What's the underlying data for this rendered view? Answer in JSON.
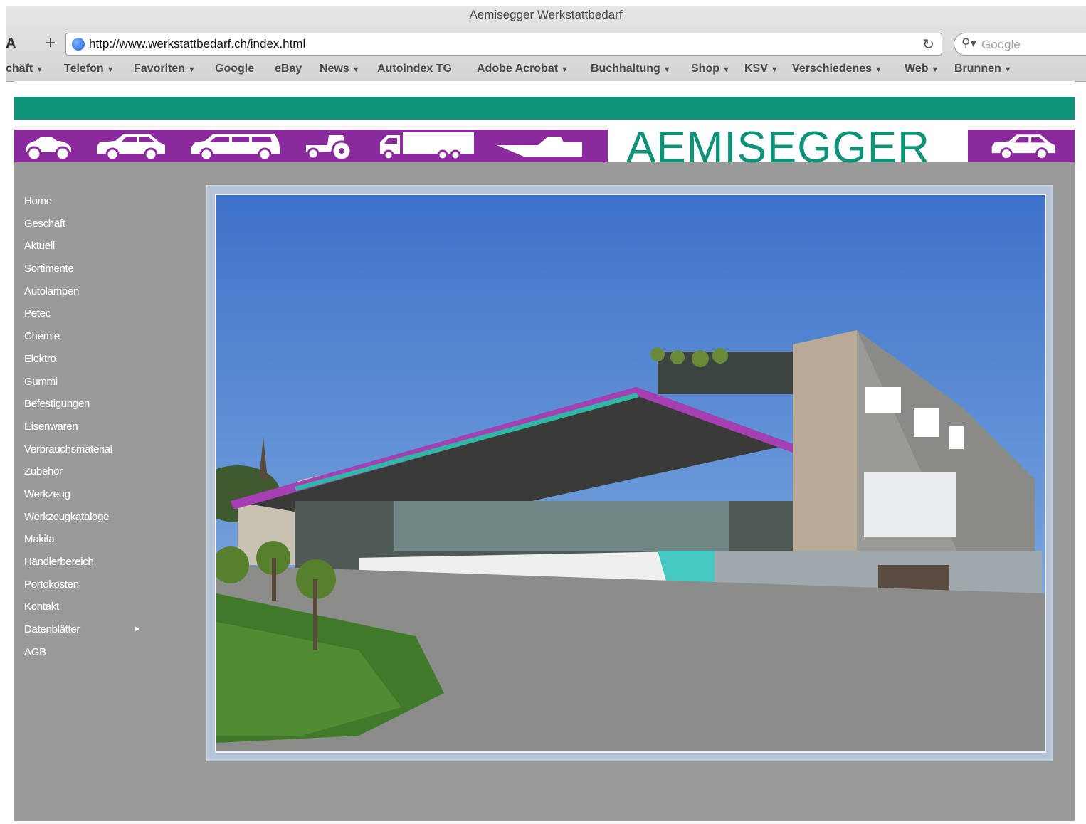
{
  "browser": {
    "window_title": "Aemisegger Werkstattbedarf",
    "left_button": "A",
    "add_button": "+",
    "url": "http://www.werkstattbedarf.ch/index.html",
    "search_placeholder": "Google",
    "bookmarks": [
      {
        "label": "chäft",
        "menu": true
      },
      {
        "label": "Telefon",
        "menu": true
      },
      {
        "label": "Favoriten",
        "menu": true
      },
      {
        "label": "Google",
        "menu": false
      },
      {
        "label": "eBay",
        "menu": false
      },
      {
        "label": "News",
        "menu": true
      },
      {
        "label": "Autoindex TG",
        "menu": false
      },
      {
        "label": "Adobe Acrobat",
        "menu": true
      },
      {
        "label": "Buchhaltung",
        "menu": true
      },
      {
        "label": "Shop",
        "menu": true
      },
      {
        "label": "KSV",
        "menu": true
      },
      {
        "label": "Verschiedenes",
        "menu": true
      },
      {
        "label": "Web",
        "menu": true
      },
      {
        "label": "Brunnen",
        "menu": true
      }
    ]
  },
  "site": {
    "brand": "AEMISEGGER",
    "colors": {
      "teal": "#0e9278",
      "purple": "#8a2a9c",
      "background": "#9a9a9a"
    },
    "vehicle_icons": [
      "quad-icon",
      "car-icon",
      "van-icon",
      "tractor-icon",
      "truck-trailer-icon",
      "boat-icon",
      "car-icon"
    ],
    "nav": [
      {
        "label": "Home"
      },
      {
        "label": "Geschäft"
      },
      {
        "label": "Aktuell"
      },
      {
        "label": "Sortimente"
      },
      {
        "label": "Autolampen"
      },
      {
        "label": "Petec"
      },
      {
        "label": "Chemie"
      },
      {
        "label": "Elektro"
      },
      {
        "label": "Gummi"
      },
      {
        "label": "Befestigungen"
      },
      {
        "label": "Eisenwaren"
      },
      {
        "label": "Verbrauchsmaterial"
      },
      {
        "label": "Zubehör"
      },
      {
        "label": "Werkzeug"
      },
      {
        "label": "Werkzeugkataloge"
      },
      {
        "label": "Makita"
      },
      {
        "label": "Händlerbereich"
      },
      {
        "label": "Portokosten"
      },
      {
        "label": "Kontakt"
      },
      {
        "label": "Datenblätter",
        "has_submenu": true
      },
      {
        "label": "AGB"
      }
    ]
  }
}
